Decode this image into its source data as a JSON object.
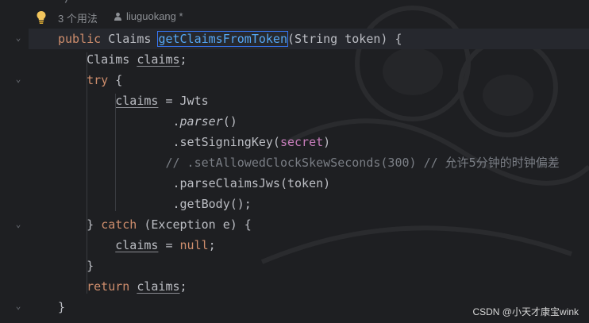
{
  "hint": {
    "usages": "3 个用法",
    "author": "liuguokang *"
  },
  "top_partial": "*/",
  "code_lines": [
    {
      "id": 0,
      "parts": [
        {
          "t": "public ",
          "c": "kw"
        },
        {
          "t": "Claims ",
          "c": "type"
        },
        {
          "t": "getClaimsFromToken",
          "c": "fn-decl"
        },
        {
          "t": "(String token) {",
          "c": "type"
        }
      ]
    },
    {
      "id": 1,
      "parts": [
        {
          "t": "    Claims ",
          "c": "type"
        },
        {
          "t": "claims",
          "c": "var-ul"
        },
        {
          "t": ";",
          "c": "type"
        }
      ]
    },
    {
      "id": 2,
      "parts": [
        {
          "t": "    ",
          "c": "type"
        },
        {
          "t": "try",
          "c": "kw"
        },
        {
          "t": " {",
          "c": "type"
        }
      ]
    },
    {
      "id": 3,
      "parts": [
        {
          "t": "        ",
          "c": "type"
        },
        {
          "t": "claims",
          "c": "var-ul"
        },
        {
          "t": " = Jwts",
          "c": "type"
        }
      ]
    },
    {
      "id": 4,
      "parts": [
        {
          "t": "                .",
          "c": "type"
        },
        {
          "t": "parser",
          "c": "method-it"
        },
        {
          "t": "()",
          "c": "type"
        }
      ]
    },
    {
      "id": 5,
      "parts": [
        {
          "t": "                .setSigningKey(",
          "c": "type"
        },
        {
          "t": "secret",
          "c": "field"
        },
        {
          "t": ")",
          "c": "type"
        }
      ]
    },
    {
      "id": 6,
      "parts": [
        {
          "t": "               // .setAllowedClockSkewSeconds(300) // 允许5分钟的时钟偏差",
          "c": "comment"
        }
      ]
    },
    {
      "id": 7,
      "parts": [
        {
          "t": "                .parseClaimsJws(token)",
          "c": "type"
        }
      ]
    },
    {
      "id": 8,
      "parts": [
        {
          "t": "                .getBody();",
          "c": "type"
        }
      ]
    },
    {
      "id": 9,
      "parts": [
        {
          "t": "    } ",
          "c": "type"
        },
        {
          "t": "catch",
          "c": "kw"
        },
        {
          "t": " (Exception e) {",
          "c": "type"
        }
      ]
    },
    {
      "id": 10,
      "parts": [
        {
          "t": "        ",
          "c": "type"
        },
        {
          "t": "claims",
          "c": "var-ul"
        },
        {
          "t": " = ",
          "c": "type"
        },
        {
          "t": "null",
          "c": "kw"
        },
        {
          "t": ";",
          "c": "type"
        }
      ]
    },
    {
      "id": 11,
      "parts": [
        {
          "t": "    }",
          "c": "type"
        }
      ]
    },
    {
      "id": 12,
      "parts": [
        {
          "t": "    ",
          "c": "type"
        },
        {
          "t": "return",
          "c": "kw"
        },
        {
          "t": " ",
          "c": "type"
        },
        {
          "t": "claims",
          "c": "var-ul"
        },
        {
          "t": ";",
          "c": "type"
        }
      ]
    },
    {
      "id": 13,
      "parts": [
        {
          "t": "}",
          "c": "type"
        }
      ]
    }
  ],
  "fold_markers": {
    "open": "⌄",
    "close": "⌄"
  },
  "watermark": "CSDN @小天才康宝wink",
  "colors": {
    "background": "#1e1f22",
    "keyword": "#cf8e6d",
    "function_declaration": "#56a8f5",
    "field": "#c77dbb",
    "comment": "#7a7e85",
    "caret_highlight": "#3574f0"
  }
}
